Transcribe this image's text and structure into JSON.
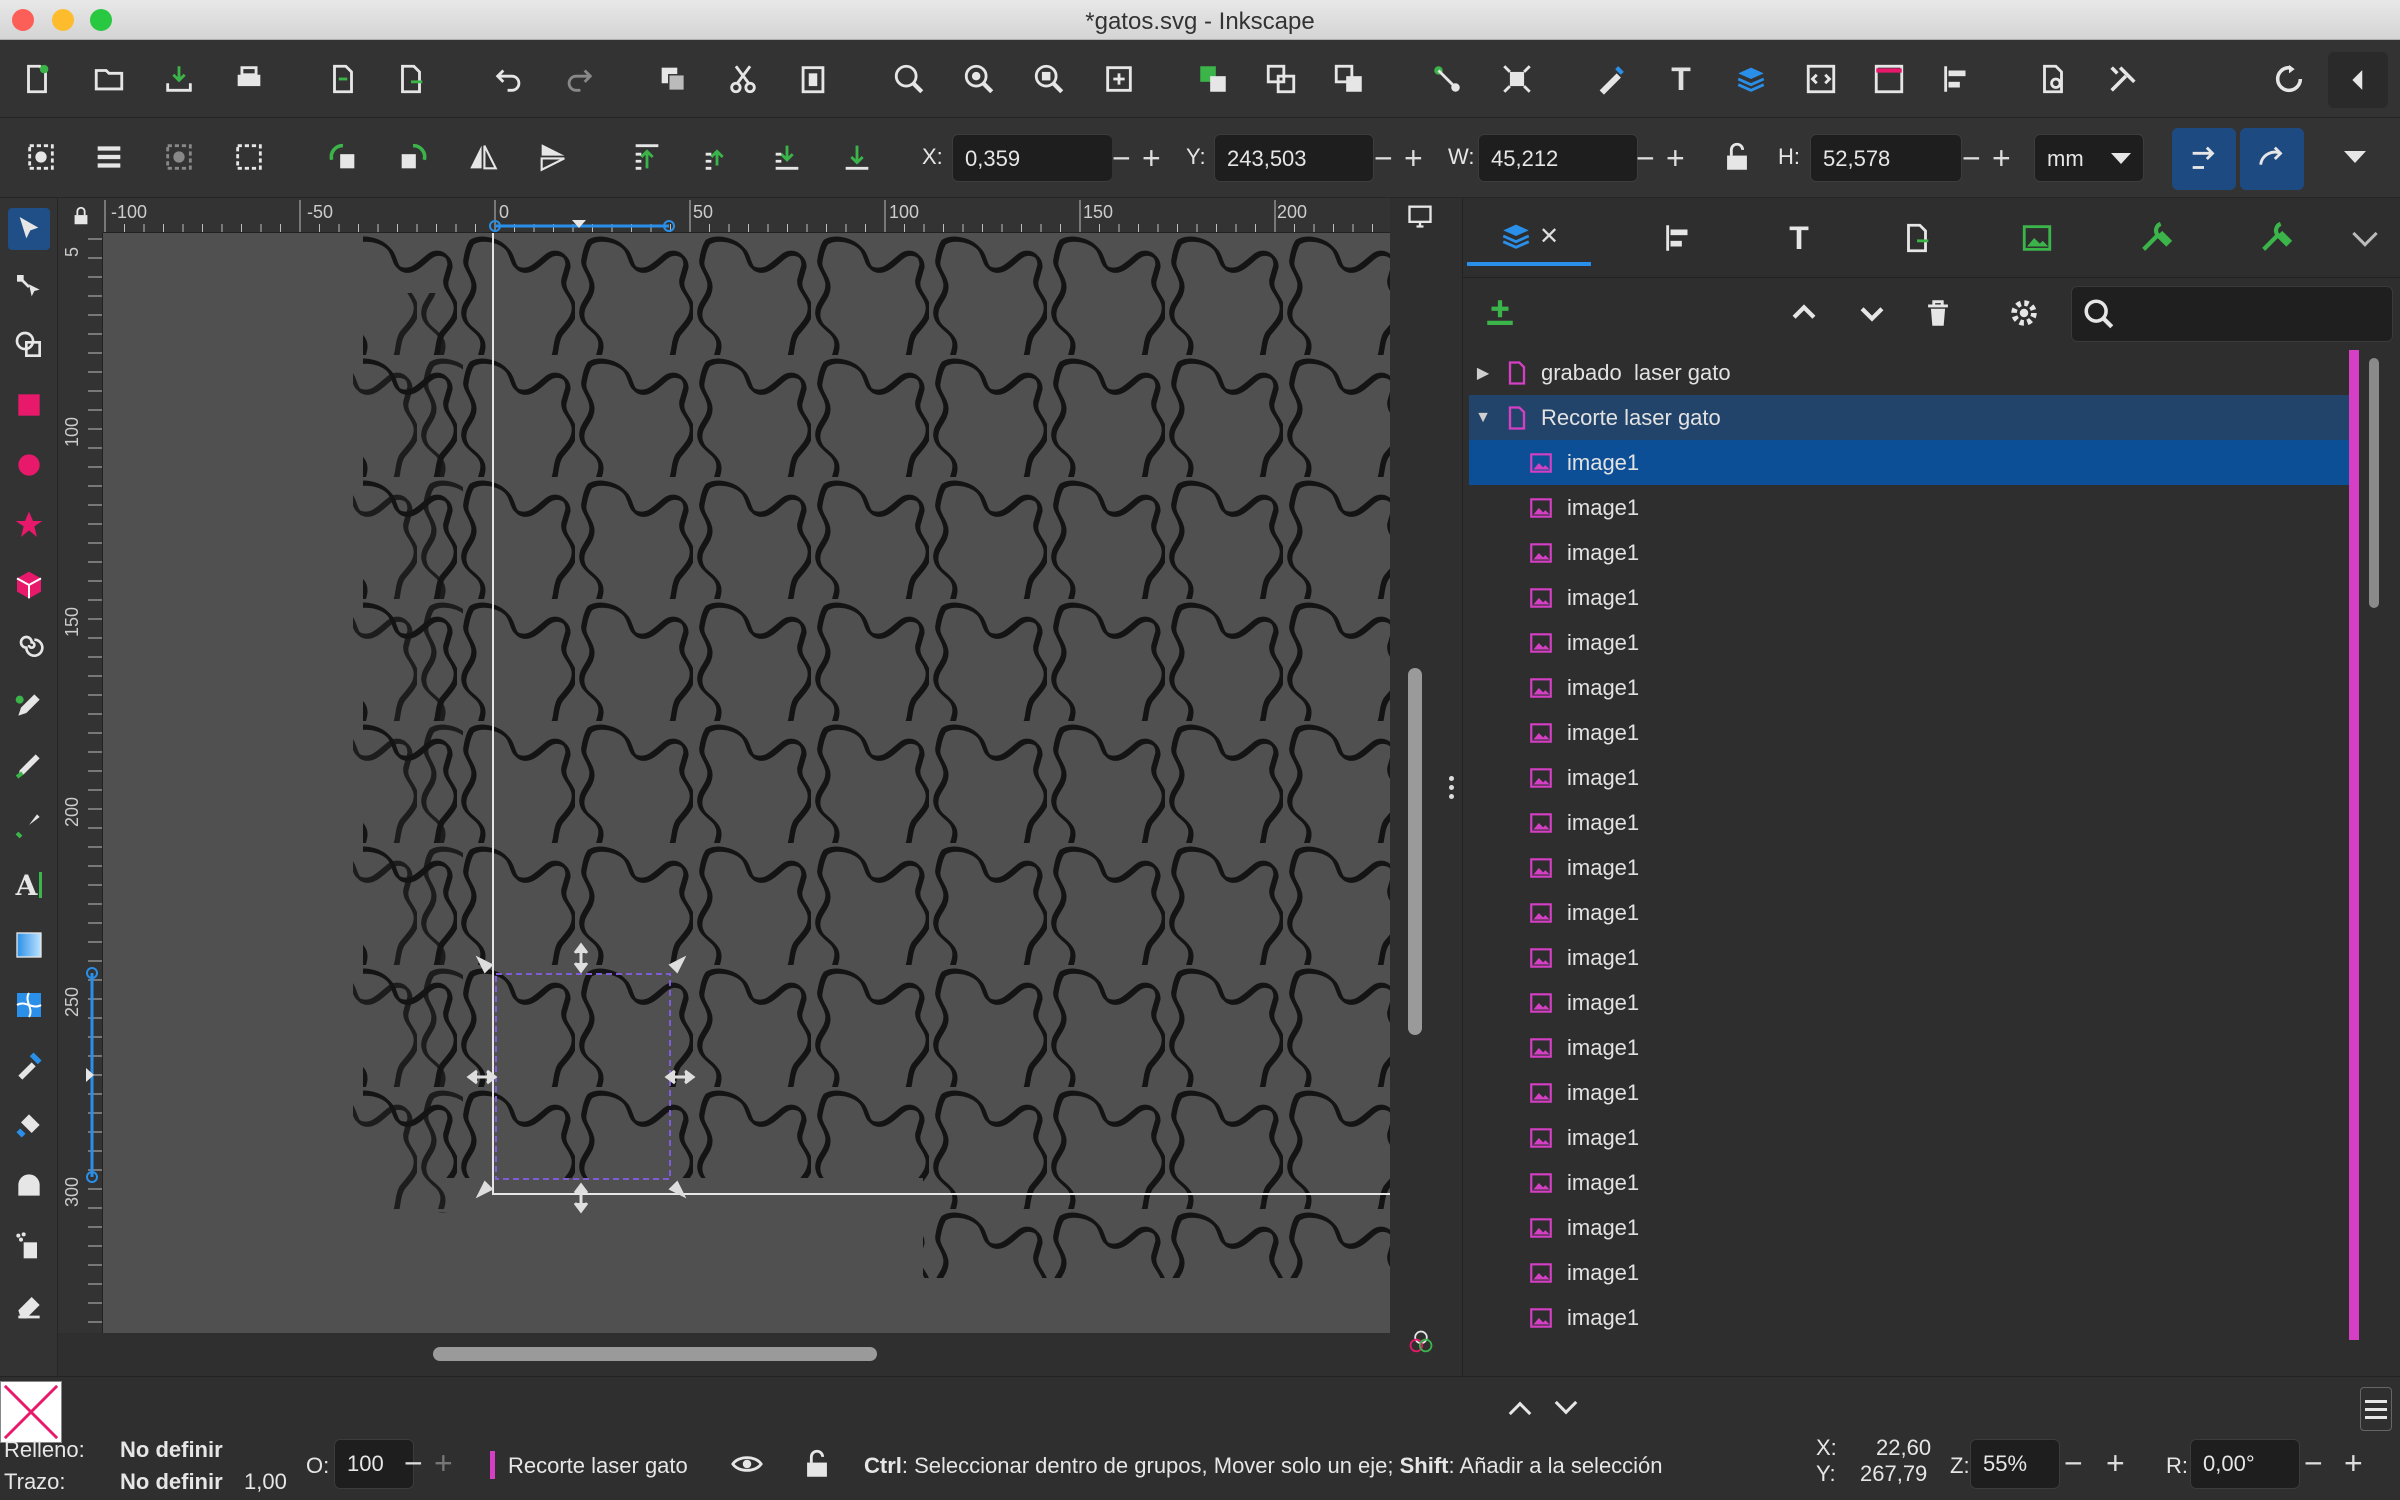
{
  "window": {
    "title": "*gatos.svg - Inkscape"
  },
  "colors": {
    "accent": "#1f4f86",
    "selection": "#0d4f97",
    "layer_stripe": "#d43fc3",
    "canvas_bg": "#505050",
    "page_border": "#e0e0e0",
    "green_icon": "#3bb54a",
    "red_icon": "#e8186a"
  },
  "toolbar_controls": {
    "x_label": "X:",
    "x_value": "0,359",
    "y_label": "Y:",
    "y_value": "243,503",
    "w_label": "W:",
    "w_value": "45,212",
    "h_label": "H:",
    "h_value": "52,578",
    "unit": "mm",
    "minus": "−",
    "plus": "+"
  },
  "rulers": {
    "horizontal_ticks": [
      "-100",
      "-50",
      "0",
      "50",
      "100",
      "150",
      "200"
    ],
    "vertical_ticks": [
      "5",
      "100",
      "150",
      "200",
      "250",
      "300"
    ]
  },
  "dock": {
    "tabs": [
      "layers-objects",
      "align",
      "text",
      "export",
      "fill",
      "preferences",
      "xml"
    ],
    "search": {
      "placeholder": ""
    },
    "layers": [
      {
        "name": "grabado  laser gato",
        "type": "layer",
        "expanded": false
      },
      {
        "name": "Recorte laser gato",
        "type": "layer",
        "expanded": true
      }
    ],
    "objects": [
      "image1",
      "image1",
      "image1",
      "image1",
      "image1",
      "image1",
      "image1",
      "image1",
      "image1",
      "image1",
      "image1",
      "image1",
      "image1",
      "image1",
      "image1",
      "image1",
      "image1",
      "image1",
      "image1",
      "image1"
    ]
  },
  "status": {
    "fill_label": "Relleno:",
    "fill_value": "No definir",
    "stroke_label": "Trazo:",
    "stroke_value": "No definir",
    "stroke_width": "1,00",
    "opacity_label": "O:",
    "opacity_value": "100",
    "layer_name": "Recorte laser gato",
    "hint_ctrl": "Ctrl",
    "hint_text1": ": Seleccionar dentro de grupos, Mover solo un eje; ",
    "hint_shift": "Shift",
    "hint_text2": ": Añadir a la selección",
    "cursor_x_label": "X:",
    "cursor_x": "22,60",
    "cursor_y_label": "Y:",
    "cursor_y": "267,79",
    "zoom_label": "Z:",
    "zoom": "55%",
    "rotate_label": "R:",
    "rotate": "0,00°"
  }
}
